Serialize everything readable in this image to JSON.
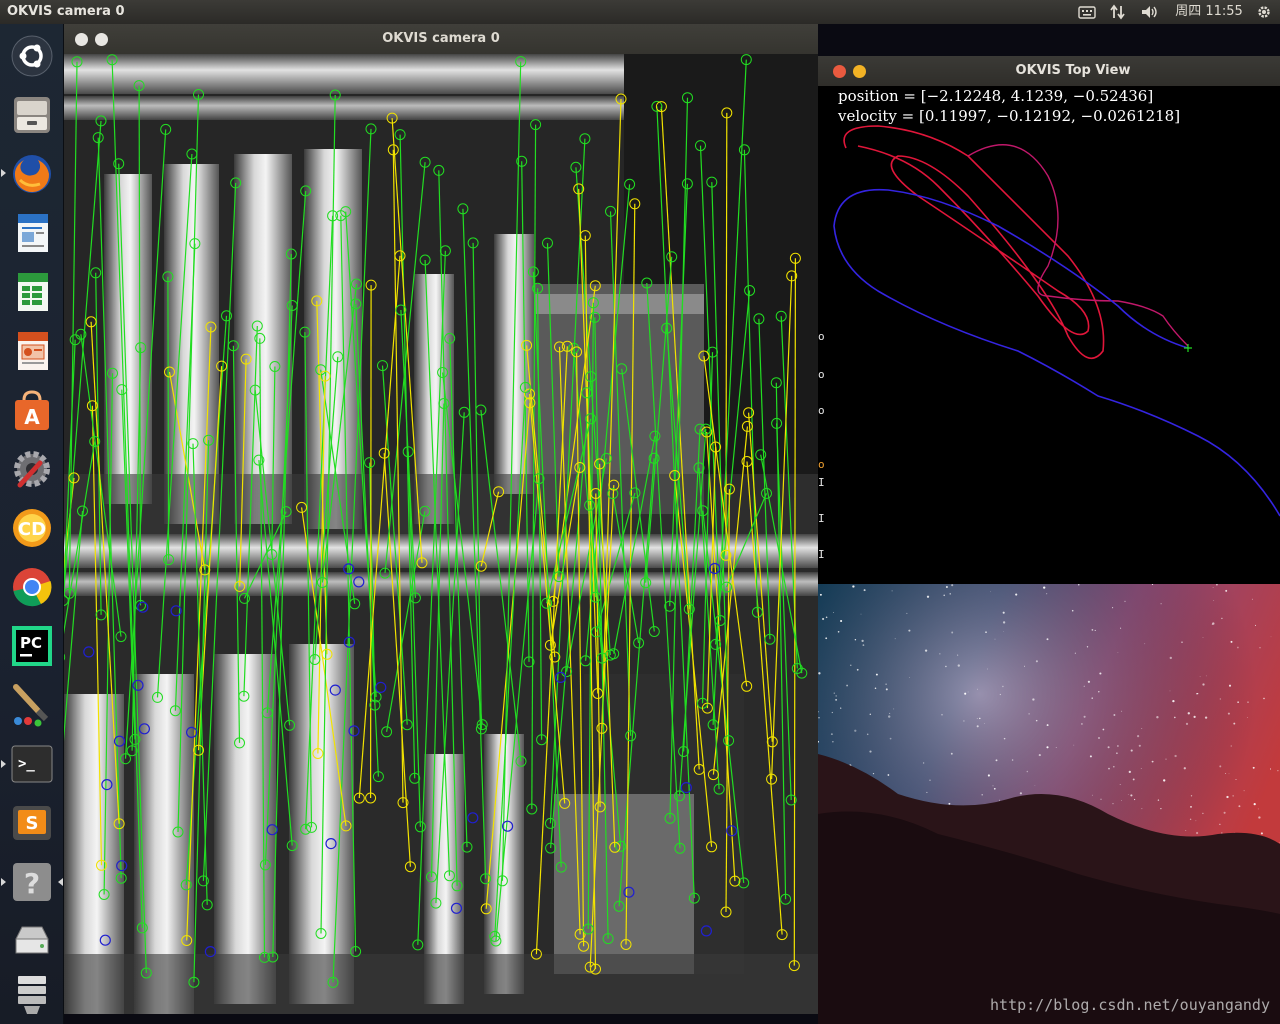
{
  "top_panel": {
    "title": "OKVIS camera 0",
    "clock": "周四 11:55"
  },
  "launcher": {
    "items": [
      {
        "name": "ubuntu-dash",
        "icon": "ubuntu-logo-icon"
      },
      {
        "name": "files",
        "icon": "file-cabinet-icon"
      },
      {
        "name": "firefox",
        "icon": "firefox-icon"
      },
      {
        "name": "libreoffice-writer",
        "icon": "document-icon"
      },
      {
        "name": "libreoffice-calc",
        "icon": "spreadsheet-icon"
      },
      {
        "name": "libreoffice-impress",
        "icon": "presentation-icon"
      },
      {
        "name": "ubuntu-software",
        "icon": "shopping-bag-icon"
      },
      {
        "name": "system-settings",
        "icon": "settings-wrench-icon"
      },
      {
        "name": "cd-burner",
        "icon": "cd-icon",
        "label": "CD"
      },
      {
        "name": "chrome",
        "icon": "chrome-icon"
      },
      {
        "name": "pycharm",
        "icon": "pycharm-icon",
        "label": "PC"
      },
      {
        "name": "paint",
        "icon": "paintbrush-icon"
      },
      {
        "name": "terminal",
        "icon": "terminal-icon",
        "label": ">_"
      },
      {
        "name": "sublime-text",
        "icon": "sublime-icon",
        "label": "S"
      },
      {
        "name": "help",
        "icon": "help-icon",
        "label": "?"
      },
      {
        "name": "drive",
        "icon": "hard-drive-icon"
      },
      {
        "name": "trash",
        "icon": "trash-icon"
      }
    ]
  },
  "camera_window": {
    "title": "OKVIS camera 0",
    "match_colors": {
      "tracked": "#22dd22",
      "new": "#f2e300",
      "unmatched": "#2020d0"
    }
  },
  "top_view_window": {
    "title": "OKVIS Top View",
    "position_text": "position = [−2.12248, 4.1239, −0.52436]",
    "velocity_text": "velocity = [0.11997, −0.12192, −0.0261218]",
    "trajectory_colors": {
      "start": "#ff1a3a",
      "end": "#3a2aff"
    }
  },
  "desktop": {
    "watermark": "http://blog.csdn.net/ouyangandy"
  }
}
